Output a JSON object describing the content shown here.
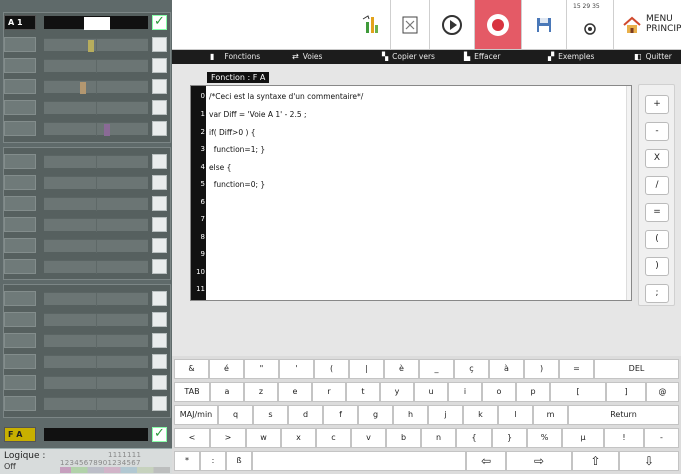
{
  "channels": {
    "active_label": "A 1",
    "fa_label": "F A"
  },
  "logic": {
    "label": "Logique :",
    "digits": "12345678901234567",
    "top_digits": "1111111",
    "state": "Off"
  },
  "toolbar": {
    "time": "15 29 35",
    "menu_label_line1": "MENU",
    "menu_label_line2": "PRINCIPA"
  },
  "menubar": {
    "items": [
      {
        "label": "Fonctions",
        "icon": "book-icon"
      },
      {
        "label": "Voies",
        "icon": "channels-icon"
      },
      {
        "label": "Copier vers",
        "icon": "copy-icon"
      },
      {
        "label": "Effacer",
        "icon": "eraser-icon"
      },
      {
        "label": "Exemples",
        "icon": "examples-icon"
      },
      {
        "label": "Quitter",
        "icon": "exit-icon"
      }
    ]
  },
  "editor": {
    "title": "Fonction : F A",
    "line_numbers": [
      "0",
      "1",
      "2",
      "3",
      "4",
      "5",
      "6",
      "7",
      "8",
      "9",
      "10",
      "11"
    ],
    "lines": [
      "/*Ceci est la syntaxe d'un commentaire*/",
      "var Diff = 'Voie A 1' - 2.5 ;",
      "if( Diff>0 ) {",
      "  function=1; }",
      "else {",
      "  function=0; }",
      "",
      "",
      "",
      "",
      "",
      ""
    ]
  },
  "operators": [
    "+",
    "-",
    "X",
    "/",
    "=",
    "(",
    ")",
    ";"
  ],
  "keyboard": {
    "row1": [
      "&",
      "é",
      "\"",
      "'",
      "(",
      "|",
      "è",
      "_",
      "ç",
      "à",
      ")",
      "=",
      "DEL"
    ],
    "row2": [
      "TAB",
      "a",
      "z",
      "e",
      "r",
      "t",
      "y",
      "u",
      "i",
      "o",
      "p",
      "[",
      "]",
      "@"
    ],
    "row3": [
      "MAJ/min",
      "q",
      "s",
      "d",
      "f",
      "g",
      "h",
      "j",
      "k",
      "l",
      "m",
      "Return"
    ],
    "row4": [
      "<",
      ">",
      "w",
      "x",
      "c",
      "v",
      "b",
      "n",
      "{",
      "}",
      "%",
      "µ",
      "!",
      "-"
    ],
    "row5": [
      "*",
      ":",
      "ß"
    ]
  }
}
